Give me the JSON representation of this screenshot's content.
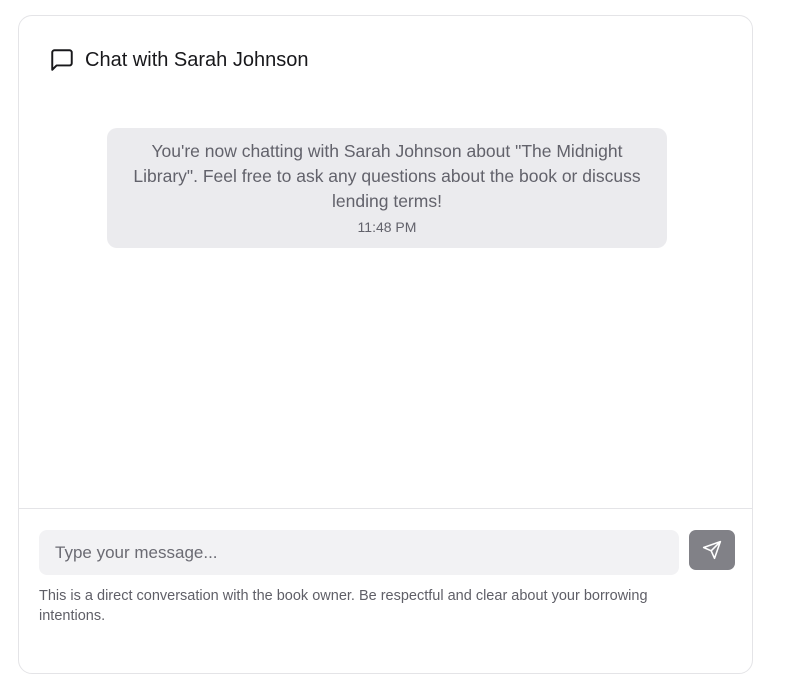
{
  "header": {
    "title": "Chat with Sarah Johnson",
    "icon": "message-square-icon"
  },
  "messages": [
    {
      "type": "system",
      "text": "You're now chatting with Sarah Johnson about \"The Midnight Library\". Feel free to ask any questions about the book or discuss lending terms!",
      "time": "11:48 PM"
    }
  ],
  "composer": {
    "placeholder": "Type your message...",
    "value": "",
    "send_icon": "send-icon"
  },
  "disclaimer": "This is a direct conversation with the book owner. Be respectful and clear about your borrowing intentions.",
  "colors": {
    "bubble_background": "#ebebee",
    "input_background": "#f2f2f4",
    "send_button": "#818187",
    "border": "#e4e4e7"
  }
}
